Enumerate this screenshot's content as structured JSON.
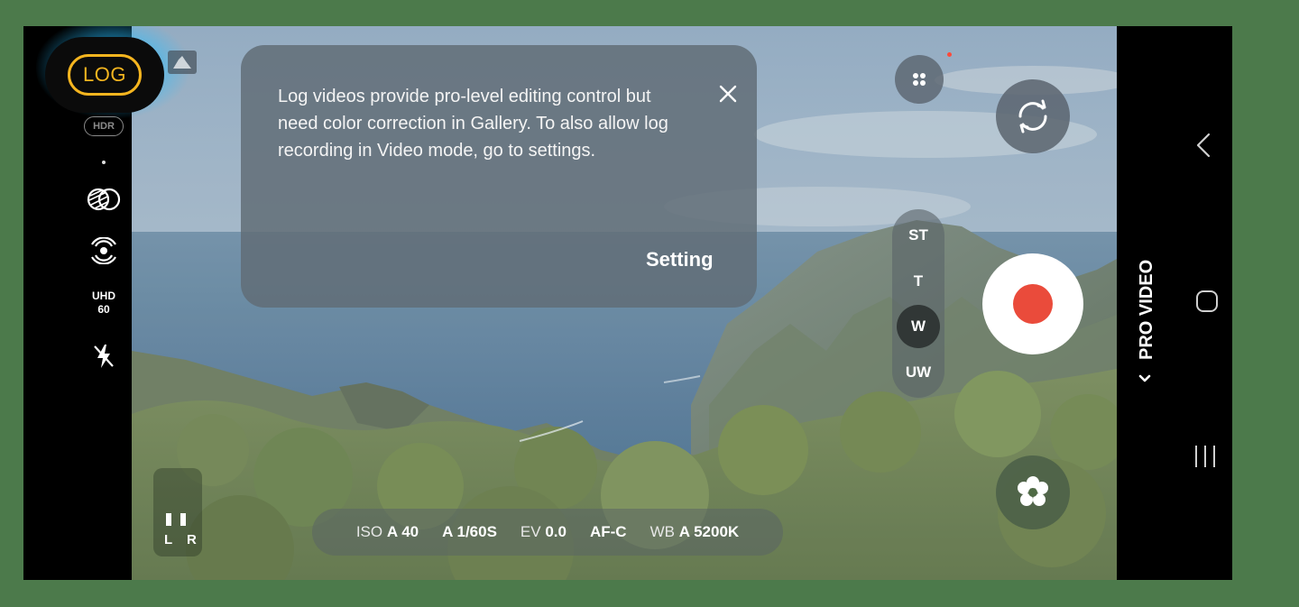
{
  "log_button": {
    "label": "LOG"
  },
  "left_rail": {
    "hdr_label": "HDR",
    "resolution": "UHD",
    "fps": "60"
  },
  "audio": {
    "channels_label": "L R"
  },
  "tooltip": {
    "message": "Log videos provide pro-level editing control but need color correction in Gallery. To also allow log recording in Video mode, go to settings.",
    "action_label": "Setting"
  },
  "settings_bar": {
    "iso_label": "ISO",
    "iso_value": "A 40",
    "shutter_value": "A 1/60S",
    "ev_label": "EV",
    "ev_value": "0.0",
    "focus_value": "AF-C",
    "wb_label": "WB",
    "wb_value": "A 5200K"
  },
  "zoom": {
    "options": [
      "ST",
      "T",
      "W",
      "UW"
    ],
    "selected": "W"
  },
  "mode": {
    "label": "PRO VIDEO"
  },
  "colors": {
    "log_accent": "#f5b51f",
    "record": "#ea4b3b",
    "glow": "#28beff"
  },
  "icons": [
    "histogram-icon",
    "filter-icon",
    "stabilization-icon",
    "flash-off-icon",
    "close-icon",
    "more-icon",
    "camera-switch-icon",
    "effects-flower-icon",
    "chevron-down-icon",
    "back-icon",
    "home-icon",
    "recent-apps-icon"
  ]
}
